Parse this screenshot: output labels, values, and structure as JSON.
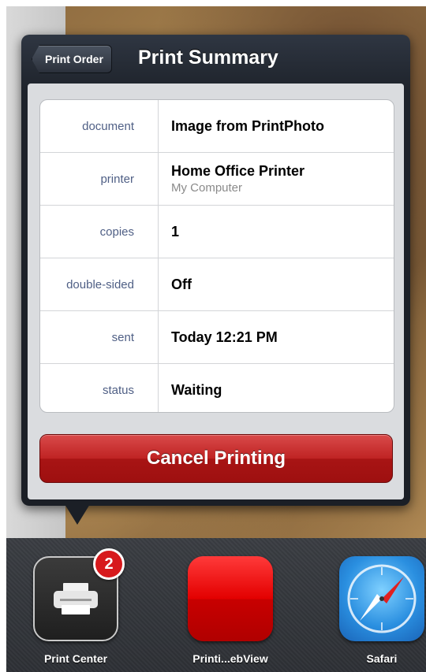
{
  "nav": {
    "back_label": "Print Order",
    "title": "Print Summary"
  },
  "summary": {
    "rows": [
      {
        "label": "document",
        "value": "Image from PrintPhoto"
      },
      {
        "label": "printer",
        "value": "Home Office Printer",
        "sub": "My Computer"
      },
      {
        "label": "copies",
        "value": "1"
      },
      {
        "label": "double-sided",
        "value": "Off"
      },
      {
        "label": "sent",
        "value": "Today 12:21 PM"
      },
      {
        "label": "status",
        "value": "Waiting"
      }
    ]
  },
  "actions": {
    "cancel_label": "Cancel Printing"
  },
  "dock": {
    "apps": [
      {
        "name": "Print Center",
        "icon": "printer-icon",
        "badge": "2"
      },
      {
        "name": "Printi...ebView",
        "icon": "red-app-icon"
      },
      {
        "name": "Safari",
        "icon": "compass-icon"
      }
    ]
  },
  "colors": {
    "label_text": "#4f5f85",
    "cancel_red": "#bf2323",
    "badge_red": "#d7191c"
  }
}
